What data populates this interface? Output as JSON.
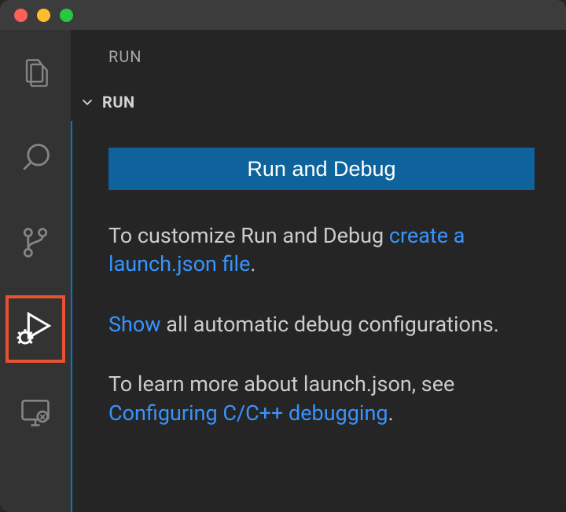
{
  "sidebar": {
    "title": "RUN",
    "section_label": "RUN"
  },
  "run_panel": {
    "button_label": "Run and Debug",
    "p1_prefix": "To customize Run and Debug ",
    "p1_link": "create a launch.json file",
    "p1_suffix": ".",
    "p2_link": "Show",
    "p2_suffix": " all automatic debug configurations.",
    "p3_prefix": "To learn more about launch.json, see ",
    "p3_link": "Configuring C/C++ debugging",
    "p3_suffix": "."
  },
  "icons": {
    "explorer": "explorer-icon",
    "search": "search-icon",
    "scm": "source-control-icon",
    "run": "run-debug-icon",
    "remote": "remote-explorer-icon"
  }
}
